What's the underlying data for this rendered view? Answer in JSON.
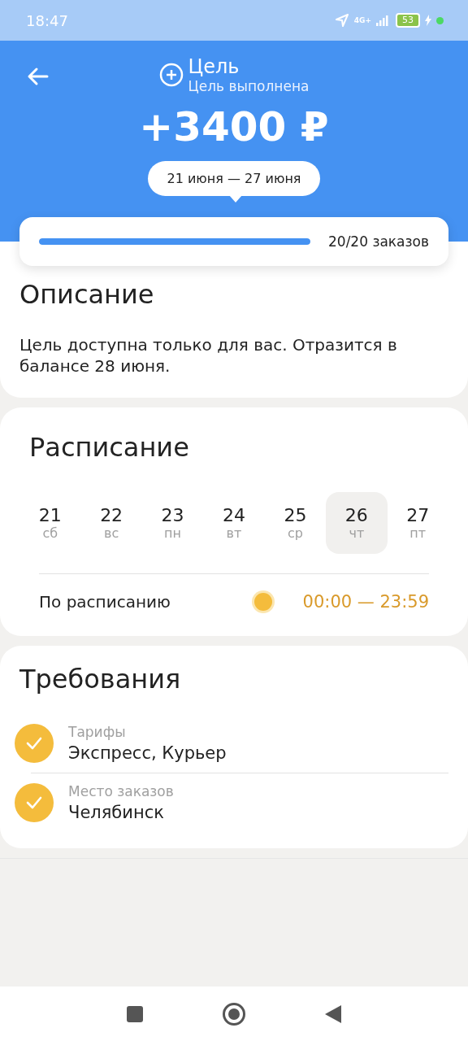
{
  "status_bar": {
    "time": "18:47",
    "network": "4G+",
    "battery": "53"
  },
  "header": {
    "title": "Цель",
    "subtitle": "Цель выполнена",
    "amount": "+3400 ₽",
    "period": "21 июня — 27 июня"
  },
  "progress": {
    "level": 1,
    "label": "20/20 заказов"
  },
  "description": {
    "title": "Описание",
    "text": "Цель доступна только для вас. Отразится в балансе 28 июня."
  },
  "schedule": {
    "title": "Расписание",
    "days": [
      {
        "date": "21",
        "weekday": "сб",
        "selected": false
      },
      {
        "date": "22",
        "weekday": "вс",
        "selected": false
      },
      {
        "date": "23",
        "weekday": "пн",
        "selected": false
      },
      {
        "date": "24",
        "weekday": "вт",
        "selected": false
      },
      {
        "date": "25",
        "weekday": "ср",
        "selected": false
      },
      {
        "date": "26",
        "weekday": "чт",
        "selected": true
      },
      {
        "date": "27",
        "weekday": "пт",
        "selected": false
      }
    ],
    "row": {
      "label": "По расписанию",
      "color": "#f4bc3c",
      "time": "00:00 — 23:59"
    }
  },
  "requirements": {
    "title": "Требования",
    "items": [
      {
        "label": "Тарифы",
        "value": "Экспресс, Курьер",
        "checked": true
      },
      {
        "label": "Место заказов",
        "value": "Челябинск",
        "checked": true
      }
    ]
  }
}
